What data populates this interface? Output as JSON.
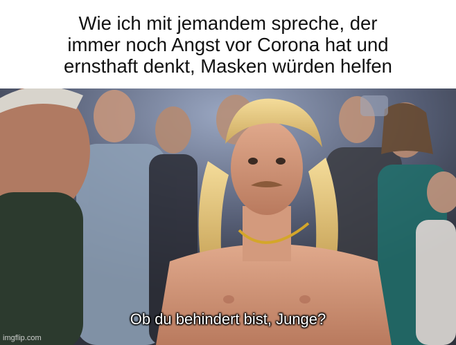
{
  "meme": {
    "top_caption_lines": [
      "Wie ich mit jemandem spreche, der",
      "immer noch Angst vor Corona hat und",
      "ernsthaft denkt, Masken würden helfen"
    ],
    "subtitle": "Ob du behindert bist, Junge?",
    "watermark": "imgflip.com"
  },
  "colors": {
    "caption_background": "#ffffff",
    "caption_text": "#111111",
    "subtitle_text": "#ffffff"
  }
}
